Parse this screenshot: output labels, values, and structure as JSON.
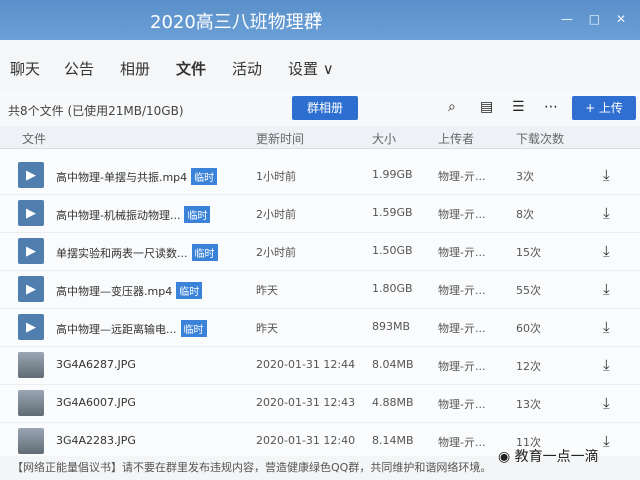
{
  "window": {
    "title": "2020高三八班物理群",
    "edit_icon": "pencil-icon",
    "controls": [
      "—",
      "□",
      "✕"
    ]
  },
  "nav": {
    "tabs": [
      "聊天",
      "公告",
      "相册",
      "文件",
      "活动",
      "设置 ∨"
    ],
    "active_tab": "文件",
    "right_icons": [
      "phone-icon",
      "message-icon",
      "more-icon"
    ]
  },
  "toolbar": {
    "summary": "共8个文件 (已使用21MB/10GB)",
    "album_button": "群相册",
    "upload_button": "+ 上传"
  },
  "table": {
    "headers": [
      "文件",
      "更新时间",
      "大小",
      "上传者",
      "下载次数"
    ],
    "rows": [
      {
        "type": "video",
        "name": "高中物理-单摆与共振.mp4",
        "badge": "临时",
        "time": "1小时前",
        "size": "1.99GB",
        "uploader": "物理-亓...",
        "count": "3次"
      },
      {
        "type": "video",
        "name": "高中物理-机械振动物理...",
        "badge": "临时",
        "time": "2小时前",
        "size": "1.59GB",
        "uploader": "物理-亓...",
        "count": "8次"
      },
      {
        "type": "video",
        "name": "单摆实验和两表一尺读数...",
        "badge": "临时",
        "time": "2小时前",
        "size": "1.50GB",
        "uploader": "物理-亓...",
        "count": "15次"
      },
      {
        "type": "video",
        "name": "高中物理—变压器.mp4",
        "badge": "临时",
        "time": "昨天",
        "size": "1.80GB",
        "uploader": "物理-亓...",
        "count": "55次"
      },
      {
        "type": "video",
        "name": "高中物理—远距离输电...",
        "badge": "临时",
        "time": "昨天",
        "size": "893MB",
        "uploader": "物理-亓...",
        "count": "60次"
      },
      {
        "type": "image",
        "name": "3G4A6287.JPG",
        "badge": "",
        "time": "2020-01-31 12:44",
        "size": "8.04MB",
        "uploader": "物理-亓...",
        "count": "12次"
      },
      {
        "type": "image",
        "name": "3G4A6007.JPG",
        "badge": "",
        "time": "2020-01-31 12:43",
        "size": "4.88MB",
        "uploader": "物理-亓...",
        "count": "13次"
      },
      {
        "type": "image",
        "name": "3G4A2283.JPG",
        "badge": "",
        "time": "2020-01-31 12:40",
        "size": "8.14MB",
        "uploader": "物理-亓...",
        "count": "11次"
      }
    ]
  },
  "notice": "【网络正能量倡议书】请不要在群里发布违规内容，营造健康绿色QQ群，共同维护和谐网络环境。",
  "watermark": "教育一点一滴"
}
